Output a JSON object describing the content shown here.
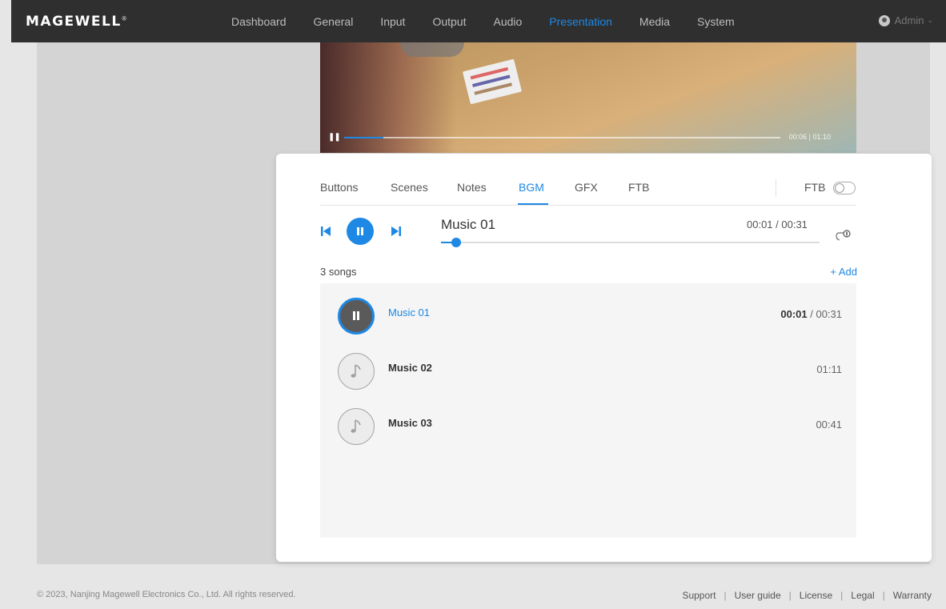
{
  "brand": {
    "logo": "MAGEWELL",
    "reg": "®"
  },
  "nav": {
    "items": [
      {
        "label": "Dashboard"
      },
      {
        "label": "General"
      },
      {
        "label": "Input"
      },
      {
        "label": "Output"
      },
      {
        "label": "Audio"
      },
      {
        "label": "Presentation",
        "active": true
      },
      {
        "label": "Media"
      },
      {
        "label": "System"
      }
    ],
    "user": "Admin"
  },
  "video": {
    "time": "00:06 | 01:10",
    "progress": 0.09
  },
  "panel": {
    "tabs": [
      {
        "label": "Buttons"
      },
      {
        "label": "Scenes"
      },
      {
        "label": "Notes"
      },
      {
        "label": "BGM",
        "active": true
      },
      {
        "label": "GFX"
      },
      {
        "label": "FTB"
      }
    ],
    "ftb_label": "FTB",
    "ftb_enabled": false,
    "player": {
      "title": "Music 01",
      "time": "00:01 / 00:31",
      "progress": 0.04
    },
    "songs_count": "3 songs",
    "add_label": "+ Add",
    "songs": [
      {
        "name": "Music 01",
        "elapsed": "00:01",
        "duration": " / 00:31",
        "state": "playing"
      },
      {
        "name": "Music 02",
        "duration": "01:11",
        "state": "idle"
      },
      {
        "name": "Music 03",
        "duration": "00:41",
        "state": "idle"
      }
    ]
  },
  "footer": {
    "copyright": "© 2023, Nanjing Magewell Electronics Co., Ltd. All rights reserved.",
    "links": [
      "Support",
      "User guide",
      "License",
      "Legal",
      "Warranty"
    ]
  },
  "colors": {
    "accent": "#1e88e5",
    "topbar": "#2f2f2f",
    "page_bg": "#e6e6e6"
  }
}
